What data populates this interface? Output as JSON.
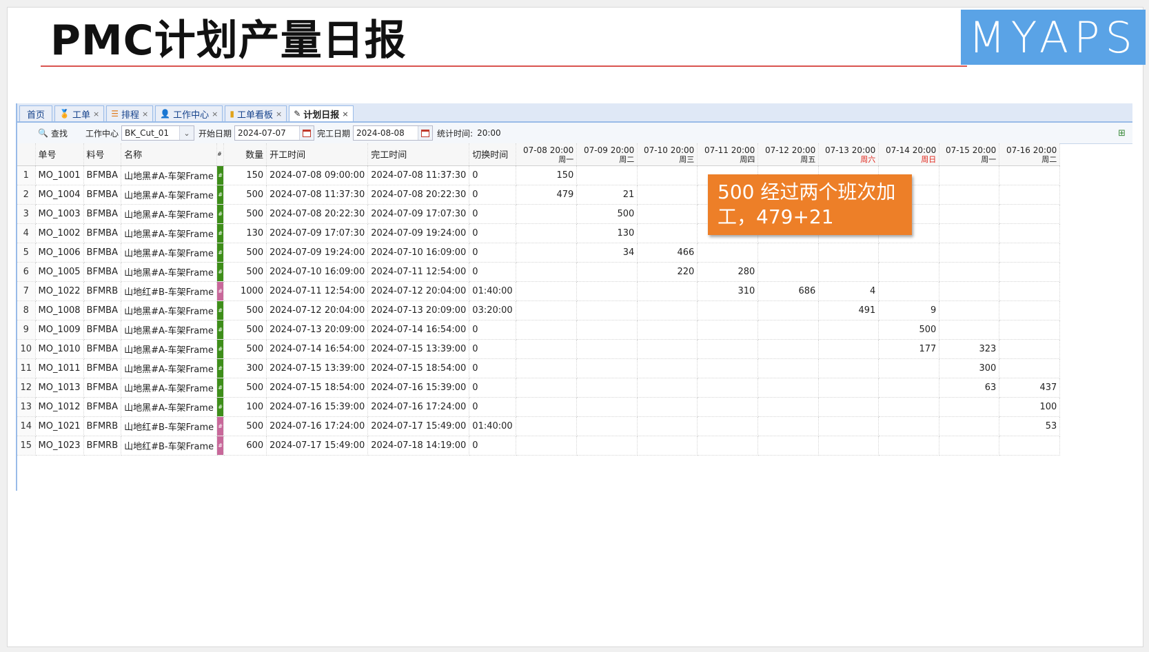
{
  "slide": {
    "title": "PMC计划产量日报",
    "logo": "MYAPS"
  },
  "tabs": [
    {
      "label": "首页",
      "icon": "home-icon",
      "closable": false,
      "active": false
    },
    {
      "label": "工单",
      "icon": "medal-icon",
      "closable": true,
      "active": false
    },
    {
      "label": "排程",
      "icon": "schedule-list-icon",
      "closable": true,
      "active": false
    },
    {
      "label": "工作中心",
      "icon": "users-icon",
      "closable": true,
      "active": false
    },
    {
      "label": "工单看板",
      "icon": "bar-chart-icon",
      "closable": true,
      "active": false
    },
    {
      "label": "计划日报",
      "icon": "edit-doc-icon",
      "closable": true,
      "active": true
    }
  ],
  "toolbar": {
    "search_label": "查找",
    "work_center_label": "工作中心",
    "work_center_value": "BK_Cut_01",
    "start_date_label": "开始日期",
    "start_date_value": "2024-07-07",
    "end_date_label": "完工日期",
    "end_date_value": "2024-08-08",
    "stat_time_label": "统计时间:",
    "stat_time_value": "20:00"
  },
  "grid": {
    "headers": {
      "order_no": "单号",
      "material": "料号",
      "name": "名称",
      "color": "#",
      "qty": "数量",
      "start": "开工时间",
      "end": "完工时间",
      "switch": "切换时间"
    },
    "days": [
      {
        "date": "07-08 20:00",
        "weekday": "周一",
        "weekend": false
      },
      {
        "date": "07-09 20:00",
        "weekday": "周二",
        "weekend": false
      },
      {
        "date": "07-10 20:00",
        "weekday": "周三",
        "weekend": false
      },
      {
        "date": "07-11 20:00",
        "weekday": "周四",
        "weekend": false
      },
      {
        "date": "07-12 20:00",
        "weekday": "周五",
        "weekend": false
      },
      {
        "date": "07-13 20:00",
        "weekday": "周六",
        "weekend": true
      },
      {
        "date": "07-14 20:00",
        "weekday": "周日",
        "weekend": true
      },
      {
        "date": "07-15 20:00",
        "weekday": "周一",
        "weekend": false
      },
      {
        "date": "07-16 20:00",
        "weekday": "周二",
        "weekend": false
      }
    ],
    "colors": {
      "green": "#3e8e1a",
      "pink": "#c8689a"
    },
    "rows": [
      {
        "n": "1",
        "order": "MO_1001",
        "mat": "BFMBA",
        "name": "山地黑#A-车架Frame",
        "color": "green",
        "qty": "150",
        "start": "2024-07-08 09:00:00",
        "end": "2024-07-08 11:37:30",
        "switch": "0",
        "days": [
          "150",
          "",
          "",
          "",
          "",
          "",
          "",
          "",
          ""
        ]
      },
      {
        "n": "2",
        "order": "MO_1004",
        "mat": "BFMBA",
        "name": "山地黑#A-车架Frame",
        "color": "green",
        "qty": "500",
        "start": "2024-07-08 11:37:30",
        "end": "2024-07-08 20:22:30",
        "switch": "0",
        "days": [
          "479",
          "21",
          "",
          "",
          "",
          "",
          "",
          "",
          ""
        ]
      },
      {
        "n": "3",
        "order": "MO_1003",
        "mat": "BFMBA",
        "name": "山地黑#A-车架Frame",
        "color": "green",
        "qty": "500",
        "start": "2024-07-08 20:22:30",
        "end": "2024-07-09 17:07:30",
        "switch": "0",
        "days": [
          "",
          "500",
          "",
          "",
          "",
          "",
          "",
          "",
          ""
        ]
      },
      {
        "n": "4",
        "order": "MO_1002",
        "mat": "BFMBA",
        "name": "山地黑#A-车架Frame",
        "color": "green",
        "qty": "130",
        "start": "2024-07-09 17:07:30",
        "end": "2024-07-09 19:24:00",
        "switch": "0",
        "days": [
          "",
          "130",
          "",
          "",
          "",
          "",
          "",
          "",
          ""
        ]
      },
      {
        "n": "5",
        "order": "MO_1006",
        "mat": "BFMBA",
        "name": "山地黑#A-车架Frame",
        "color": "green",
        "qty": "500",
        "start": "2024-07-09 19:24:00",
        "end": "2024-07-10 16:09:00",
        "switch": "0",
        "days": [
          "",
          "34",
          "466",
          "",
          "",
          "",
          "",
          "",
          ""
        ]
      },
      {
        "n": "6",
        "order": "MO_1005",
        "mat": "BFMBA",
        "name": "山地黑#A-车架Frame",
        "color": "green",
        "qty": "500",
        "start": "2024-07-10 16:09:00",
        "end": "2024-07-11 12:54:00",
        "switch": "0",
        "days": [
          "",
          "",
          "220",
          "280",
          "",
          "",
          "",
          "",
          ""
        ]
      },
      {
        "n": "7",
        "order": "MO_1022",
        "mat": "BFMRB",
        "name": "山地红#B-车架Frame",
        "color": "pink",
        "qty": "1000",
        "start": "2024-07-11 12:54:00",
        "end": "2024-07-12 20:04:00",
        "switch": "01:40:00",
        "days": [
          "",
          "",
          "",
          "310",
          "686",
          "4",
          "",
          "",
          ""
        ]
      },
      {
        "n": "8",
        "order": "MO_1008",
        "mat": "BFMBA",
        "name": "山地黑#A-车架Frame",
        "color": "green",
        "qty": "500",
        "start": "2024-07-12 20:04:00",
        "end": "2024-07-13 20:09:00",
        "switch": "03:20:00",
        "days": [
          "",
          "",
          "",
          "",
          "",
          "491",
          "9",
          "",
          ""
        ]
      },
      {
        "n": "9",
        "order": "MO_1009",
        "mat": "BFMBA",
        "name": "山地黑#A-车架Frame",
        "color": "green",
        "qty": "500",
        "start": "2024-07-13 20:09:00",
        "end": "2024-07-14 16:54:00",
        "switch": "0",
        "days": [
          "",
          "",
          "",
          "",
          "",
          "",
          "500",
          "",
          ""
        ]
      },
      {
        "n": "10",
        "order": "MO_1010",
        "mat": "BFMBA",
        "name": "山地黑#A-车架Frame",
        "color": "green",
        "qty": "500",
        "start": "2024-07-14 16:54:00",
        "end": "2024-07-15 13:39:00",
        "switch": "0",
        "days": [
          "",
          "",
          "",
          "",
          "",
          "",
          "177",
          "323",
          ""
        ]
      },
      {
        "n": "11",
        "order": "MO_1011",
        "mat": "BFMBA",
        "name": "山地黑#A-车架Frame",
        "color": "green",
        "qty": "300",
        "start": "2024-07-15 13:39:00",
        "end": "2024-07-15 18:54:00",
        "switch": "0",
        "days": [
          "",
          "",
          "",
          "",
          "",
          "",
          "",
          "300",
          ""
        ]
      },
      {
        "n": "12",
        "order": "MO_1013",
        "mat": "BFMBA",
        "name": "山地黑#A-车架Frame",
        "color": "green",
        "qty": "500",
        "start": "2024-07-15 18:54:00",
        "end": "2024-07-16 15:39:00",
        "switch": "0",
        "days": [
          "",
          "",
          "",
          "",
          "",
          "",
          "",
          "63",
          "437"
        ]
      },
      {
        "n": "13",
        "order": "MO_1012",
        "mat": "BFMBA",
        "name": "山地黑#A-车架Frame",
        "color": "green",
        "qty": "100",
        "start": "2024-07-16 15:39:00",
        "end": "2024-07-16 17:24:00",
        "switch": "0",
        "days": [
          "",
          "",
          "",
          "",
          "",
          "",
          "",
          "",
          "100"
        ]
      },
      {
        "n": "14",
        "order": "MO_1021",
        "mat": "BFMRB",
        "name": "山地红#B-车架Frame",
        "color": "pink",
        "qty": "500",
        "start": "2024-07-16 17:24:00",
        "end": "2024-07-17 15:49:00",
        "switch": "01:40:00",
        "days": [
          "",
          "",
          "",
          "",
          "",
          "",
          "",
          "",
          "53"
        ]
      },
      {
        "n": "15",
        "order": "MO_1023",
        "mat": "BFMRB",
        "name": "山地红#B-车架Frame",
        "color": "pink",
        "qty": "600",
        "start": "2024-07-17 15:49:00",
        "end": "2024-07-18 14:19:00",
        "switch": "0",
        "days": [
          "",
          "",
          "",
          "",
          "",
          "",
          "",
          "",
          ""
        ]
      }
    ]
  },
  "callout": {
    "text": "500 经过两个班次加工，479+21",
    "color": "#ed7f28"
  }
}
